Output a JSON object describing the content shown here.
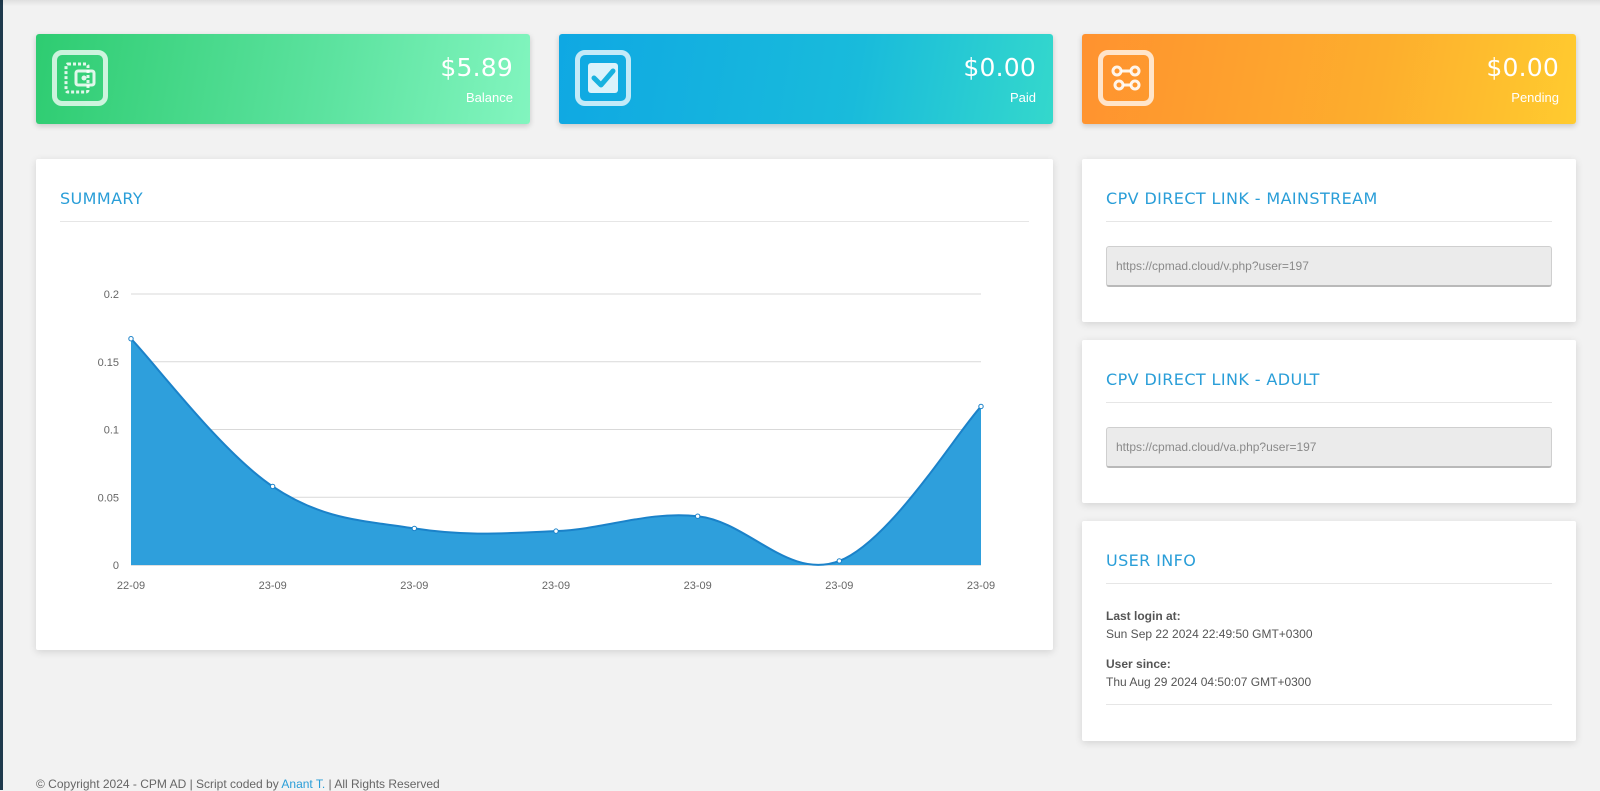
{
  "cards": {
    "balance": {
      "value": "$5.89",
      "label": "Balance",
      "icon": "wallet-icon"
    },
    "paid": {
      "value": "$0.00",
      "label": "Paid",
      "icon": "checkbox-checked-icon"
    },
    "pending": {
      "value": "$0.00",
      "label": "Pending",
      "icon": "pending-flow-icon"
    }
  },
  "summary": {
    "title": "SUMMARY"
  },
  "chart_data": {
    "type": "area",
    "title": "",
    "categories": [
      "22-09",
      "23-09",
      "23-09",
      "23-09",
      "23-09",
      "23-09",
      "23-09"
    ],
    "values": [
      0.167,
      0.058,
      0.027,
      0.025,
      0.036,
      0.003,
      0.117
    ],
    "ylim": [
      0,
      0.2
    ],
    "yticks": [
      0,
      0.05,
      0.1,
      0.15,
      0.2
    ],
    "ytick_labels": [
      "0",
      "0.05",
      "0.1",
      "0.15",
      "0.2"
    ],
    "grid": true,
    "color": "#2a9ddb"
  },
  "mainstream": {
    "title": "CPV DIRECT LINK - MAINSTREAM",
    "url": "https://cpmad.cloud/v.php?user=197"
  },
  "adult": {
    "title": "CPV DIRECT LINK - ADULT",
    "url": "https://cpmad.cloud/va.php?user=197"
  },
  "user_info": {
    "title": "USER INFO",
    "last_login_label": "Last login at:",
    "last_login_value": "Sun Sep 22 2024 22:49:50 GMT+0300",
    "user_since_label": "User since:",
    "user_since_value": "Thu Aug 29 2024 04:50:07 GMT+0300"
  },
  "footer": {
    "prefix": "© Copyright 2024 - CPM AD | Script coded by ",
    "author": "Anant T.",
    "suffix": " | All Rights Reserved"
  }
}
